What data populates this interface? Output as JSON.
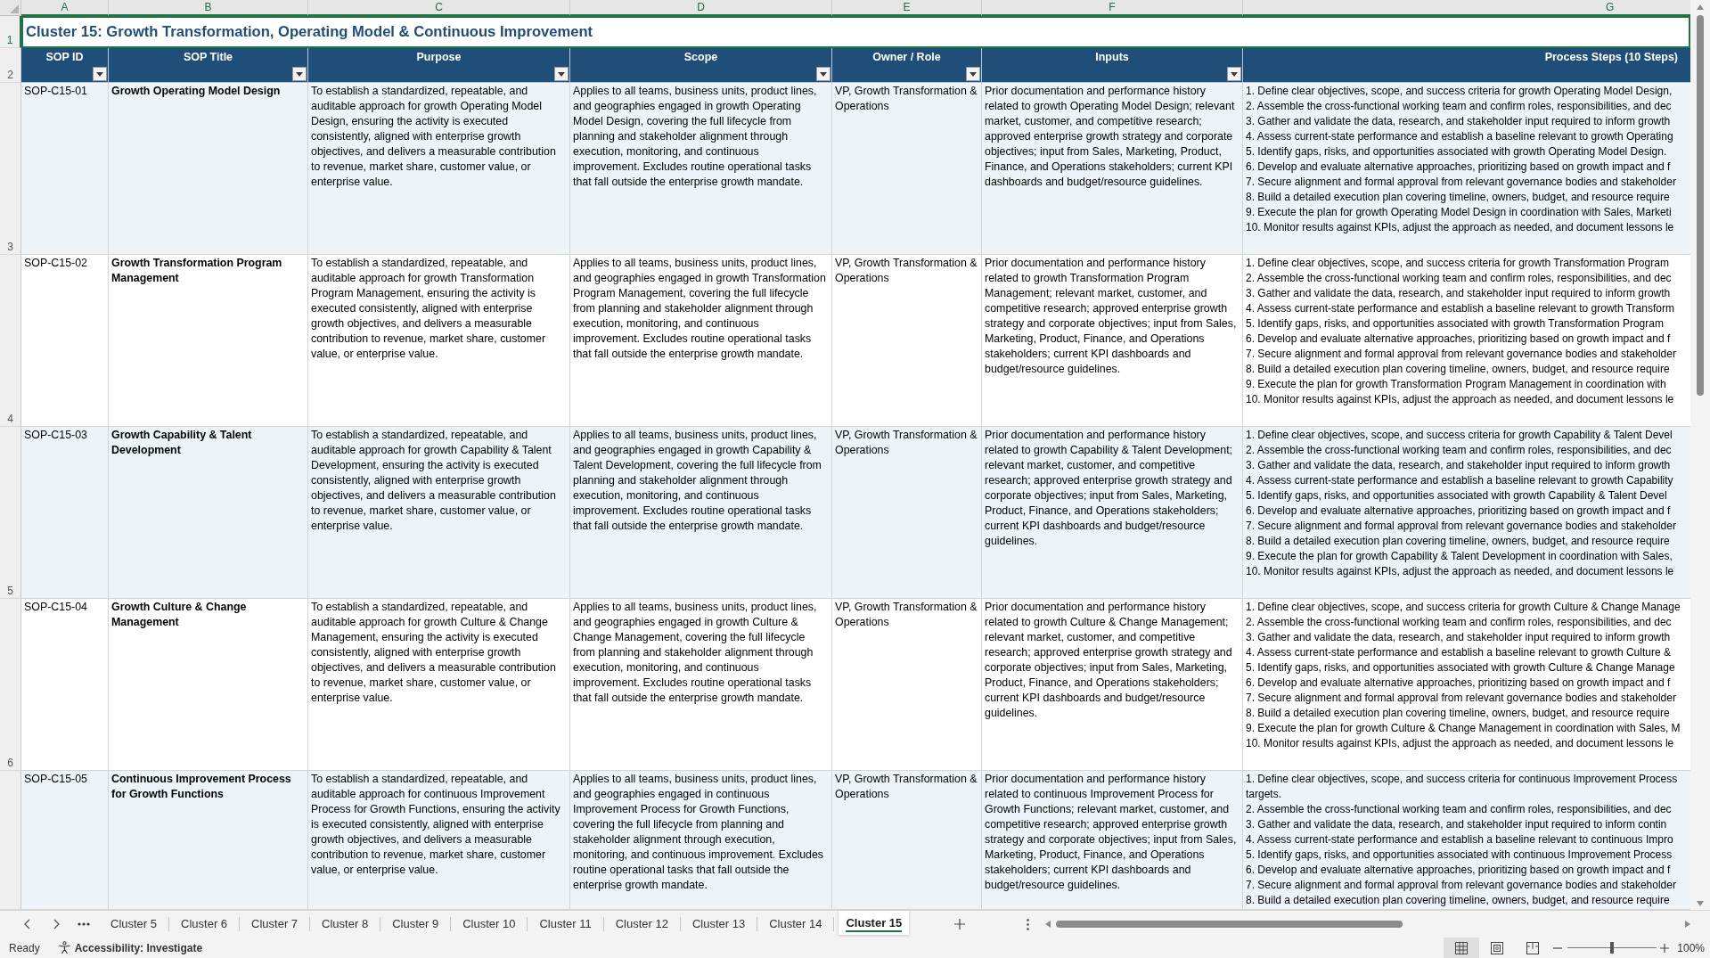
{
  "column_headers": [
    {
      "label": "A",
      "selected": true
    },
    {
      "label": "B",
      "selected": true
    },
    {
      "label": "C",
      "selected": true
    },
    {
      "label": "D",
      "selected": true
    },
    {
      "label": "E",
      "selected": true
    },
    {
      "label": "F",
      "selected": true
    },
    {
      "label": "G",
      "selected": true
    }
  ],
  "row_headers": [
    {
      "label": "1",
      "selected": true
    },
    {
      "label": "2",
      "selected": false
    },
    {
      "label": "3",
      "selected": false
    },
    {
      "label": "4",
      "selected": false
    },
    {
      "label": "5",
      "selected": false
    },
    {
      "label": "6",
      "selected": false
    }
  ],
  "title": {
    "text": "Cluster 15: Growth Transformation, Operating Model & Continuous Improvement",
    "selected": true
  },
  "table": {
    "columns": [
      {
        "label": "SOP ID",
        "filter": true
      },
      {
        "label": "SOP Title",
        "filter": true
      },
      {
        "label": "Purpose",
        "filter": true
      },
      {
        "label": "Scope",
        "filter": true
      },
      {
        "label": "Owner / Role",
        "filter": true
      },
      {
        "label": "Inputs",
        "filter": true
      },
      {
        "label": "Process Steps (10 Steps)",
        "filter": false
      }
    ],
    "rows": [
      {
        "sop_id": "SOP-C15-01",
        "sop_title": "Growth Operating Model Design",
        "purpose": "To establish a standardized, repeatable, and auditable approach for growth Operating Model Design, ensuring the activity is executed consistently, aligned with enterprise growth objectives, and delivers a measurable contribution to revenue, market share, customer value, or enterprise value.",
        "scope": "Applies to all teams, business units, product lines, and geographies engaged in growth Operating Model Design, covering the full lifecycle from planning and stakeholder alignment through execution, monitoring, and continuous improvement. Excludes routine operational tasks that fall outside the enterprise growth mandate.",
        "owner_role": "VP, Growth Transformation & Operations",
        "inputs": "Prior documentation and performance history related to growth Operating Model Design; relevant market, customer, and competitive research; approved enterprise growth strategy and corporate objectives; input from Sales, Marketing, Product, Finance, and Operations stakeholders; current KPI dashboards and budget/resource guidelines.",
        "process_steps": [
          "1. Define clear objectives, scope, and success criteria for growth Operating Model Design,",
          "2. Assemble the cross-functional working team and confirm roles, responsibilities, and dec",
          "3. Gather and validate the data, research, and stakeholder input required to inform growth",
          "4. Assess current-state performance and establish a baseline relevant to growth Operating",
          "5. Identify gaps, risks, and opportunities associated with growth Operating Model Design.",
          "6. Develop and evaluate alternative approaches, prioritizing based on growth impact and f",
          "7. Secure alignment and formal approval from relevant governance bodies and stakeholder",
          "8. Build a detailed execution plan covering timeline, owners, budget, and resource require",
          "9. Execute the plan for growth Operating Model Design in coordination with Sales, Marketi",
          "10. Monitor results against KPIs, adjust the approach as needed, and document lessons le"
        ]
      },
      {
        "sop_id": "SOP-C15-02",
        "sop_title": "Growth Transformation Program Management",
        "purpose": "To establish a standardized, repeatable, and auditable approach for growth Transformation Program Management, ensuring the activity is executed consistently, aligned with enterprise growth objectives, and delivers a measurable contribution to revenue, market share, customer value, or enterprise value.",
        "scope": "Applies to all teams, business units, product lines, and geographies engaged in growth Transformation Program Management, covering the full lifecycle from planning and stakeholder alignment through execution, monitoring, and continuous improvement. Excludes routine operational tasks that fall outside the enterprise growth mandate.",
        "owner_role": "VP, Growth Transformation & Operations",
        "inputs": "Prior documentation and performance history related to growth Transformation Program Management; relevant market, customer, and competitive research; approved enterprise growth strategy and corporate objectives; input from Sales, Marketing, Product, Finance, and Operations stakeholders; current KPI dashboards and budget/resource guidelines.",
        "process_steps": [
          "1. Define clear objectives, scope, and success criteria for growth Transformation Program",
          "2. Assemble the cross-functional working team and confirm roles, responsibilities, and dec",
          "3. Gather and validate the data, research, and stakeholder input required to inform growth",
          "4. Assess current-state performance and establish a baseline relevant to growth Transform",
          "5. Identify gaps, risks, and opportunities associated with growth Transformation Program",
          "6. Develop and evaluate alternative approaches, prioritizing based on growth impact and f",
          "7. Secure alignment and formal approval from relevant governance bodies and stakeholder",
          "8. Build a detailed execution plan covering timeline, owners, budget, and resource require",
          "9. Execute the plan for growth Transformation Program Management in coordination with",
          "10. Monitor results against KPIs, adjust the approach as needed, and document lessons le"
        ]
      },
      {
        "sop_id": "SOP-C15-03",
        "sop_title": "Growth Capability & Talent Development",
        "purpose": "To establish a standardized, repeatable, and auditable approach for growth Capability & Talent Development, ensuring the activity is executed consistently, aligned with enterprise growth objectives, and delivers a measurable contribution to revenue, market share, customer value, or enterprise value.",
        "scope": "Applies to all teams, business units, product lines, and geographies engaged in growth Capability & Talent Development, covering the full lifecycle from planning and stakeholder alignment through execution, monitoring, and continuous improvement. Excludes routine operational tasks that fall outside the enterprise growth mandate.",
        "owner_role": "VP, Growth Transformation & Operations",
        "inputs": "Prior documentation and performance history related to growth Capability & Talent Development; relevant market, customer, and competitive research; approved enterprise growth strategy and corporate objectives; input from Sales, Marketing, Product, Finance, and Operations stakeholders; current KPI dashboards and budget/resource guidelines.",
        "process_steps": [
          "1. Define clear objectives, scope, and success criteria for growth Capability & Talent Devel",
          "2. Assemble the cross-functional working team and confirm roles, responsibilities, and dec",
          "3. Gather and validate the data, research, and stakeholder input required to inform growth",
          "4. Assess current-state performance and establish a baseline relevant to growth Capability",
          "5. Identify gaps, risks, and opportunities associated with growth Capability & Talent Devel",
          "6. Develop and evaluate alternative approaches, prioritizing based on growth impact and f",
          "7. Secure alignment and formal approval from relevant governance bodies and stakeholder",
          "8. Build a detailed execution plan covering timeline, owners, budget, and resource require",
          "9. Execute the plan for growth Capability & Talent Development in coordination with Sales,",
          "10. Monitor results against KPIs, adjust the approach as needed, and document lessons le"
        ]
      },
      {
        "sop_id": "SOP-C15-04",
        "sop_title": "Growth Culture & Change Management",
        "purpose": "To establish a standardized, repeatable, and auditable approach for growth Culture & Change Management, ensuring the activity is executed consistently, aligned with enterprise growth objectives, and delivers a measurable contribution to revenue, market share, customer value, or enterprise value.",
        "scope": "Applies to all teams, business units, product lines, and geographies engaged in growth Culture & Change Management, covering the full lifecycle from planning and stakeholder alignment through execution, monitoring, and continuous improvement. Excludes routine operational tasks that fall outside the enterprise growth mandate.",
        "owner_role": "VP, Growth Transformation & Operations",
        "inputs": "Prior documentation and performance history related to growth Culture & Change Management; relevant market, customer, and competitive research; approved enterprise growth strategy and corporate objectives; input from Sales, Marketing, Product, Finance, and Operations stakeholders; current KPI dashboards and budget/resource guidelines.",
        "process_steps": [
          "1. Define clear objectives, scope, and success criteria for growth Culture & Change Manage",
          "2. Assemble the cross-functional working team and confirm roles, responsibilities, and dec",
          "3. Gather and validate the data, research, and stakeholder input required to inform growth",
          "4. Assess current-state performance and establish a baseline relevant to growth Culture &",
          "5. Identify gaps, risks, and opportunities associated with growth Culture & Change Manage",
          "6. Develop and evaluate alternative approaches, prioritizing based on growth impact and f",
          "7. Secure alignment and formal approval from relevant governance bodies and stakeholder",
          "8. Build a detailed execution plan covering timeline, owners, budget, and resource require",
          "9. Execute the plan for growth Culture & Change Management in coordination with Sales, M",
          "10. Monitor results against KPIs, adjust the approach as needed, and document lessons le"
        ]
      },
      {
        "sop_id": "SOP-C15-05",
        "sop_title": "Continuous Improvement Process for Growth Functions",
        "purpose": "To establish a standardized, repeatable, and auditable approach for continuous Improvement Process for Growth Functions, ensuring the activity is executed consistently, aligned with enterprise growth objectives, and delivers a measurable contribution to revenue, market share, customer value, or enterprise value.",
        "scope": "Applies to all teams, business units, product lines, and geographies engaged in continuous Improvement Process for Growth Functions, covering the full lifecycle from planning and stakeholder alignment through execution, monitoring, and continuous improvement. Excludes routine operational tasks that fall outside the enterprise growth mandate.",
        "owner_role": "VP, Growth Transformation & Operations",
        "inputs": "Prior documentation and performance history related to continuous Improvement Process for Growth Functions; relevant market, customer, and competitive research; approved enterprise growth strategy and corporate objectives; input from Sales, Marketing, Product, Finance, and Operations stakeholders; current KPI dashboards and budget/resource guidelines.",
        "process_steps": [
          "1. Define clear objectives, scope, and success criteria for continuous Improvement Process",
          "targets.",
          "2. Assemble the cross-functional working team and confirm roles, responsibilities, and dec",
          "3. Gather and validate the data, research, and stakeholder input required to inform contin",
          "4. Assess current-state performance and establish a baseline relevant to continuous Impro",
          "5. Identify gaps, risks, and opportunities associated with continuous Improvement Process",
          "6. Develop and evaluate alternative approaches, prioritizing based on growth impact and f",
          "7. Secure alignment and formal approval from relevant governance bodies and stakeholder",
          "8. Build a detailed execution plan covering timeline, owners, budget, and resource require"
        ]
      }
    ]
  },
  "sheet_tabs": [
    {
      "label": "Cluster 5",
      "selected": false
    },
    {
      "label": "Cluster 6",
      "selected": false
    },
    {
      "label": "Cluster 7",
      "selected": false
    },
    {
      "label": "Cluster 8",
      "selected": false
    },
    {
      "label": "Cluster 9",
      "selected": false
    },
    {
      "label": "Cluster 10",
      "selected": false
    },
    {
      "label": "Cluster 11",
      "selected": false
    },
    {
      "label": "Cluster 12",
      "selected": false
    },
    {
      "label": "Cluster 13",
      "selected": false
    },
    {
      "label": "Cluster 14",
      "selected": false
    },
    {
      "label": "Cluster 15",
      "selected": true
    }
  ],
  "status_bar": {
    "status": "Ready",
    "accessibility": "Accessibility: Investigate",
    "views": [
      {
        "kind": "normal",
        "selected": true
      },
      {
        "kind": "page_layout",
        "selected": false
      },
      {
        "kind": "page_break_preview",
        "selected": false
      }
    ],
    "zoom_slider": {
      "level": 0.5
    },
    "zoom": "100%"
  }
}
